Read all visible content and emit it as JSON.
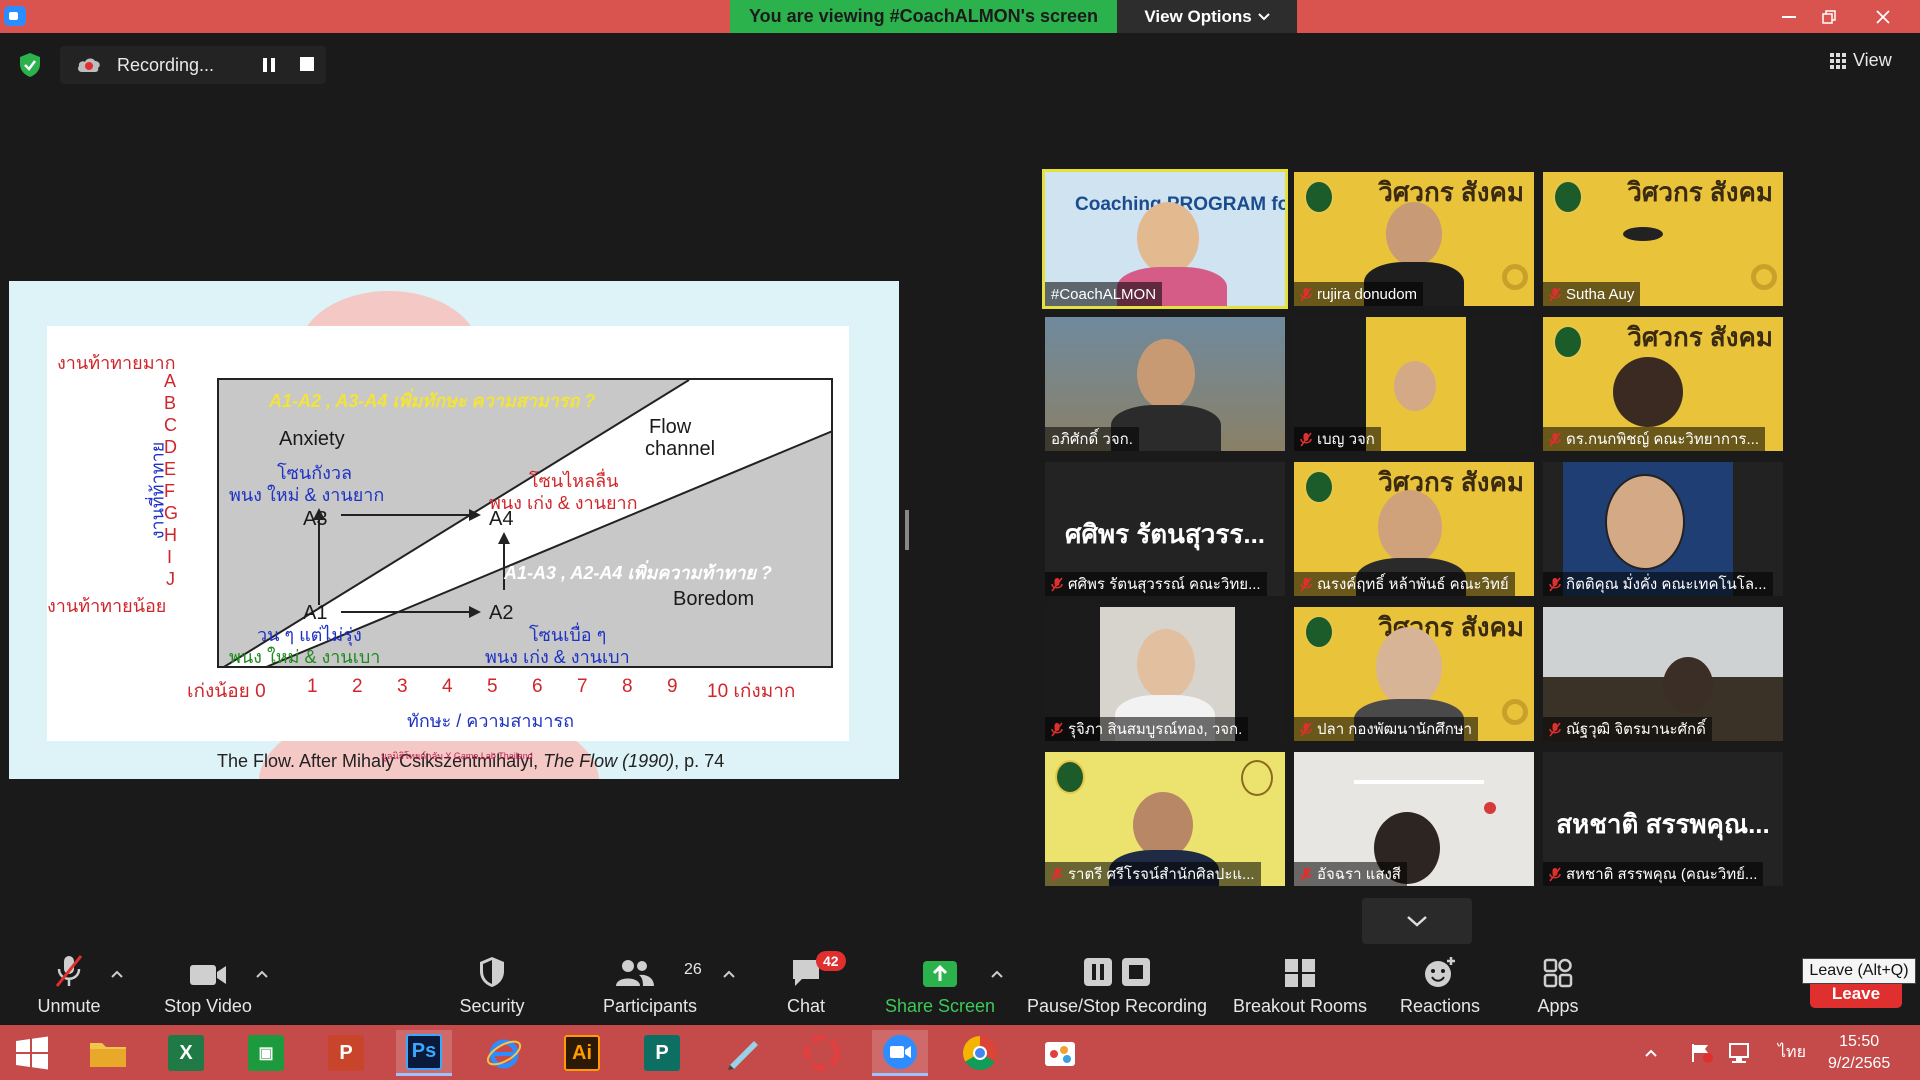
{
  "window": {
    "banner": "You are viewing #CoachALMON's screen",
    "view_options": "View Options"
  },
  "recording": {
    "label": "Recording..."
  },
  "view_button": "View",
  "slide": {
    "header_banner": "A1-A2 , A3-A4 เพิ่มทักษะ ความสามารถ ?",
    "mid_banner": "A1-A3 , A2-A4 เพิ่มความท้าทาย ?",
    "anxiety": "Anxiety",
    "flow_line1": "Flow",
    "flow_line2": "channel",
    "boredom": "Boredom",
    "zone_worry": "โซนกังวล",
    "zone_worry_desc": "พนง ใหม่ & งานยาก",
    "zone_flow": "โซนไหลลื่น",
    "zone_flow_desc": "พนง เก่ง & งานยาก",
    "zone_bored": "โซนเบื่อ ๆ",
    "zone_bored_desc": "พนง เก่ง & งานเบา",
    "zone_idle": "วน ๆ แต่ไม่รุ่ง",
    "zone_idle_desc": "พนง ใหม่ & งานเบา",
    "a1": "A1",
    "a2": "A2",
    "a3": "A3",
    "a4": "A4",
    "y_top": "งานท้าทายมาก",
    "y_bottom": "งานท้าทายน้อย",
    "y_axis": "งานที่ท้าทาย",
    "y_categories": [
      "A",
      "B",
      "C",
      "D",
      "E",
      "F",
      "G",
      "H",
      "I",
      "J"
    ],
    "x_left": "เก่งน้อย 0",
    "x_ticks": [
      "1",
      "2",
      "3",
      "4",
      "5",
      "6",
      "7",
      "8",
      "9"
    ],
    "x_right": "10 เก่งมาก",
    "x_axis": "ทักษะ / ความสามารถ",
    "caption_prefix": "The Flow.  After Mihaly Csikszentmihalyi, ",
    "caption_italic": "The Flow (1990)",
    "caption_suffix": ", p. 74",
    "footer": "มูลนิธิโทยค์กลับ X Game Lab Thailand"
  },
  "gallery": [
    {
      "name": "#CoachALMON",
      "type": "video",
      "muted": false,
      "bg_text": "Coaching PROGRAM for Leader"
    },
    {
      "name": "rujira donudom",
      "type": "video",
      "muted": true
    },
    {
      "name": "Sutha Auy",
      "type": "video",
      "muted": true
    },
    {
      "name": "อภิศักดิ์ วจก.",
      "type": "video",
      "muted": false
    },
    {
      "name": "เบญ วจก",
      "type": "video",
      "muted": true
    },
    {
      "name": "ดร.กนกพิชญ์ คณะวิทยาการ...",
      "type": "video",
      "muted": true
    },
    {
      "name": "ศศิพร รัตนสุวรรณ์ คณะวิทย...",
      "type": "name",
      "muted": true,
      "display": "ศศิพร รัตนสุวรร..."
    },
    {
      "name": "ณรงค์ฤทธิ์ หล้าพันธ์ คณะวิทย์",
      "type": "video",
      "muted": true
    },
    {
      "name": "กิตติคุณ มั่งคั่ง คณะเทคโนโล...",
      "type": "video",
      "muted": true
    },
    {
      "name": "รุจิภา สินสมบูรณ์ทอง, วจก.",
      "type": "video",
      "muted": true
    },
    {
      "name": "ปลา กองพัฒนานักศึกษา",
      "type": "video",
      "muted": true
    },
    {
      "name": "ณัฐวุฒิ จิตรมานะศักดิ์",
      "type": "video",
      "muted": true
    },
    {
      "name": "ราตรี   ศรีโรจน์สำนักศิลปะแ...",
      "type": "video",
      "muted": true
    },
    {
      "name": "อัจฉรา แสงสี",
      "type": "video",
      "muted": true
    },
    {
      "name": "สหชาติ สรรพคุณ (คณะวิทย์...",
      "type": "name",
      "muted": true,
      "display": "สหชาติ สรรพคุณ..."
    }
  ],
  "logo_text": "วิศวกร สังคม",
  "toolbar": {
    "unmute": "Unmute",
    "stop_video": "Stop Video",
    "security": "Security",
    "participants": "Participants",
    "participants_count": "26",
    "chat": "Chat",
    "chat_badge": "42",
    "share_screen": "Share Screen",
    "pause_stop_recording": "Pause/Stop Recording",
    "breakout_rooms": "Breakout Rooms",
    "reactions": "Reactions",
    "apps": "Apps",
    "leave": "Leave",
    "leave_tooltip": "Leave (Alt+Q)"
  },
  "taskbar": {
    "apps": [
      "start",
      "file-explorer",
      "excel",
      "store",
      "powerpoint",
      "photoshop",
      "internet-explorer",
      "illustrator",
      "publisher",
      "notepad",
      "photoscape",
      "zoom",
      "chrome",
      "paint"
    ],
    "illustrator_label": "Ai",
    "photoshop_label": "Ps",
    "language": "ไทย",
    "time": "15:50",
    "date": "9/2/2565"
  },
  "colors": {
    "banner_green": "#2bb24c",
    "title_red": "#d9534f",
    "leave_red": "#e02f2f",
    "share_green": "#2bb24c"
  }
}
